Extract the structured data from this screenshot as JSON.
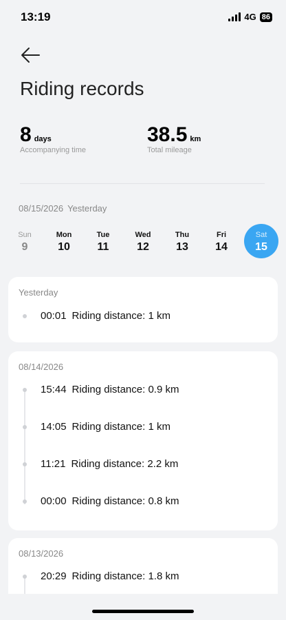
{
  "status_bar": {
    "time": "13:19",
    "network": "4G",
    "battery": "86"
  },
  "header": {
    "title": "Riding records"
  },
  "stats": [
    {
      "value": "8",
      "unit": "days",
      "label": "Accompanying time"
    },
    {
      "value": "38.5",
      "unit": "km",
      "label": "Total mileage"
    }
  ],
  "selected_date": {
    "date": "08/15/2026",
    "relative": "Yesterday"
  },
  "week": [
    {
      "name": "Sun",
      "num": "9"
    },
    {
      "name": "Mon",
      "num": "10"
    },
    {
      "name": "Tue",
      "num": "11"
    },
    {
      "name": "Wed",
      "num": "12"
    },
    {
      "name": "Thu",
      "num": "13"
    },
    {
      "name": "Fri",
      "num": "14"
    },
    {
      "name": "Sat",
      "num": "15"
    }
  ],
  "records": [
    {
      "date": "Yesterday",
      "entries": [
        {
          "time": "00:01",
          "text": "Riding distance: 1 km"
        }
      ]
    },
    {
      "date": "08/14/2026",
      "entries": [
        {
          "time": "15:44",
          "text": "Riding distance: 0.9 km"
        },
        {
          "time": "14:05",
          "text": "Riding distance: 1 km"
        },
        {
          "time": "11:21",
          "text": "Riding distance: 2.2 km"
        },
        {
          "time": "00:00",
          "text": "Riding distance: 0.8 km"
        }
      ]
    },
    {
      "date": "08/13/2026",
      "entries": [
        {
          "time": "20:29",
          "text": "Riding distance: 1.8 km"
        }
      ]
    }
  ]
}
